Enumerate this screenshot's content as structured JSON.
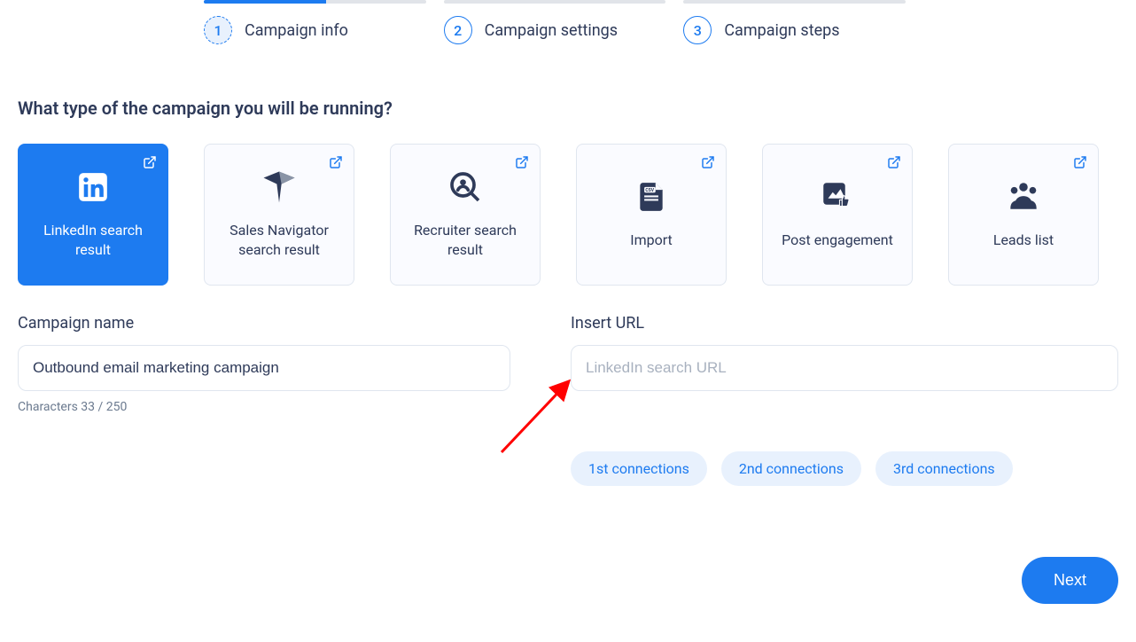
{
  "stepper": {
    "steps": [
      {
        "num": "1",
        "label": "Campaign info",
        "progress_pct": 55,
        "active": true
      },
      {
        "num": "2",
        "label": "Campaign settings",
        "progress_pct": 0,
        "active": false
      },
      {
        "num": "3",
        "label": "Campaign steps",
        "progress_pct": 0,
        "active": false
      }
    ]
  },
  "heading": "What type of the campaign you will be running?",
  "cards": [
    {
      "id": "linkedin-search",
      "label": "LinkedIn search result",
      "selected": true,
      "icon": "linkedin"
    },
    {
      "id": "sales-navigator",
      "label": "Sales Navigator search result",
      "selected": false,
      "icon": "compass"
    },
    {
      "id": "recruiter",
      "label": "Recruiter search result",
      "selected": false,
      "icon": "magnify-person"
    },
    {
      "id": "import",
      "label": "Import",
      "selected": false,
      "icon": "csv-file"
    },
    {
      "id": "post-engagement",
      "label": "Post engagement",
      "selected": false,
      "icon": "post-thumb"
    },
    {
      "id": "leads-list",
      "label": "Leads list",
      "selected": false,
      "icon": "people"
    }
  ],
  "form": {
    "campaign_name_label": "Campaign name",
    "campaign_name_value": "Outbound email marketing campaign",
    "char_counter": "Characters 33 / 250",
    "url_label": "Insert URL",
    "url_placeholder": "LinkedIn search URL",
    "url_value": ""
  },
  "chips": [
    "1st connections",
    "2nd connections",
    "3rd connections"
  ],
  "next_label": "Next",
  "colors": {
    "primary": "#1d7bf0",
    "dark_navy": "#2e3a59",
    "light_blue": "#e8f1fd",
    "arrow": "#ff0000"
  }
}
